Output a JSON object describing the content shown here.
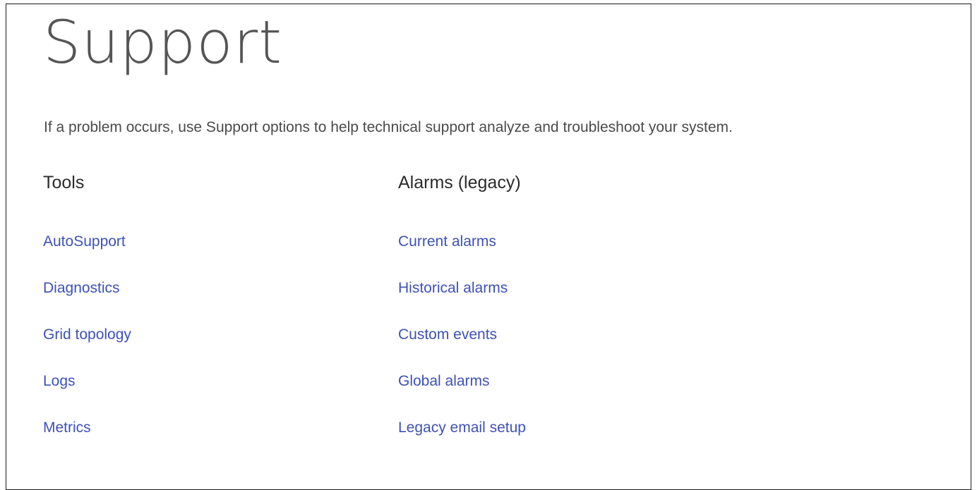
{
  "page": {
    "title": "Support",
    "description": "If a problem occurs, use Support options to help technical support analyze and troubleshoot your system."
  },
  "sections": {
    "tools": {
      "heading": "Tools",
      "links": [
        {
          "label": "AutoSupport"
        },
        {
          "label": "Diagnostics"
        },
        {
          "label": "Grid topology"
        },
        {
          "label": "Logs"
        },
        {
          "label": "Metrics"
        }
      ]
    },
    "alarms": {
      "heading": "Alarms (legacy)",
      "links": [
        {
          "label": "Current alarms"
        },
        {
          "label": "Historical alarms"
        },
        {
          "label": "Custom events"
        },
        {
          "label": "Global alarms"
        },
        {
          "label": "Legacy email setup"
        }
      ]
    }
  },
  "colors": {
    "link": "#3f51b5",
    "title": "#555555",
    "text": "#4a4a4a",
    "heading": "#2b2b2b"
  }
}
